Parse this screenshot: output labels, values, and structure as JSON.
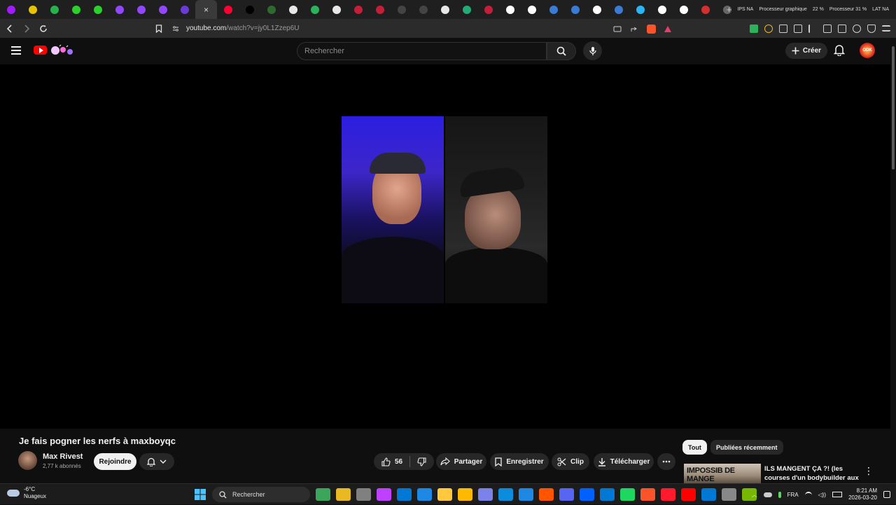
{
  "browser": {
    "active_tab_close": "×",
    "tab_favicon_colors": [
      "#a01cff",
      "#e6c200",
      "#25b34a",
      "#2bd12b",
      "#2bd12b",
      "#9146ff",
      "#9146ff",
      "#9146ff",
      "#6b3bd9",
      "#3a3a3a",
      "#ff0033",
      "#000000",
      "#2d6a2d",
      "#e8e8e8",
      "#2bb35a",
      "#e8e8e8",
      "#c41e3a",
      "#c41e3a",
      "#444444",
      "#444444",
      "#e8e8e8",
      "#2a7",
      "#c41e3a",
      "#ffffff",
      "#ffffff",
      "#3a7bd5",
      "#3a7bd5",
      "#ffffff",
      "#3a7bd5",
      "#29b6f6",
      "#ffffff",
      "#ffffff",
      "#d32f2f",
      "#666666"
    ],
    "sys_stats": [
      "IPS NA",
      "Processeur graphique",
      "22 %",
      "Processeur 31 %",
      "LAT NA"
    ],
    "url_host": "youtube.com",
    "url_path": "/watch?v=jy0L1Zzep6U"
  },
  "youtube": {
    "search_placeholder": "Rechercher",
    "create_label": "Créer",
    "avatar_text": "ODK"
  },
  "video": {
    "title": "Je fais pogner les nerfs à maxboyqc",
    "channel_name": "Max Rivest",
    "subscribers": "2,77 k abonnés",
    "join_label": "Rejoindre",
    "like_count": "56",
    "share_label": "Partager",
    "save_label": "Enregistrer",
    "clip_label": "Clip",
    "download_label": "Télécharger"
  },
  "sidebar": {
    "chips": [
      "Tout",
      "Publiées récemment"
    ],
    "recommendation": {
      "thumb_text": "IMPOSSIB DE MANGE",
      "title": "ILS MANGENT ÇA ?! (les courses d'un bodybuilder aux ..."
    }
  },
  "taskbar": {
    "temperature": "-6°C",
    "weather": "Nuageux",
    "search_label": "Rechercher",
    "language": "FRA",
    "time": "8:21 AM",
    "date": "2026-03-20",
    "app_colors": [
      "#3ba55c",
      "#e8b923",
      "#808080",
      "#c040ff",
      "#0078d4",
      "#1e88e5",
      "#ffc83d",
      "#ffb900",
      "#7b83eb",
      "#0b8cdc",
      "#1e88e5",
      "#ff5500",
      "#5865f2",
      "#0061ff",
      "#0078d4",
      "#1ed760",
      "#fb542b",
      "#ff1b2d",
      "#ff0000",
      "#0078d4",
      "#888888",
      "#76b900"
    ]
  }
}
